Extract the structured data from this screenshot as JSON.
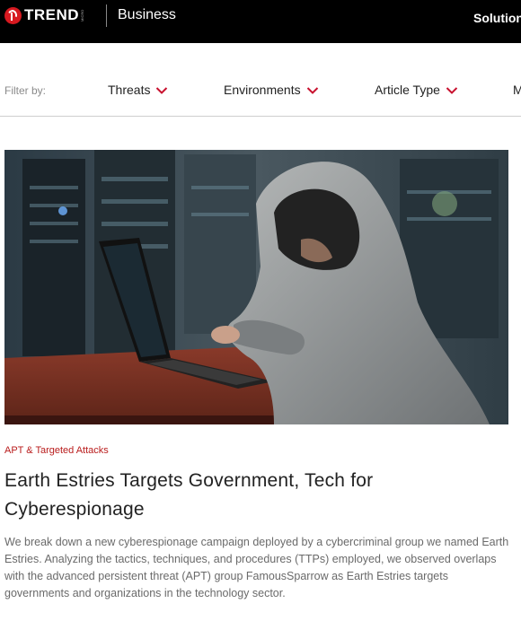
{
  "header": {
    "brand": "TREND",
    "brand_small": "MICRO",
    "section": "Business",
    "nav_item": "Solution"
  },
  "filter_bar": {
    "label": "Filter by:",
    "items": [
      {
        "label": "Threats"
      },
      {
        "label": "Environments"
      },
      {
        "label": "Article Type"
      },
      {
        "label": "M"
      }
    ]
  },
  "article": {
    "category": "APT & Targeted Attacks",
    "title": "Earth Estries Targets Government, Tech for Cyberespionage",
    "summary": "We break down a new cyberespionage campaign deployed by a cybercriminal group we named Earth Estries. Analyzing the tactics, techniques, and procedures (TTPs) employed, we observed overlaps with the advanced persistent threat (APT) group FamousSparrow as Earth Estries targets governments and organizations in the technology sector."
  },
  "colors": {
    "brand_red": "#d71920",
    "category_red": "#b91c1c",
    "chevron_red": "#c8102e"
  },
  "icons": {
    "logo": "trend-micro-logo",
    "dropdown": "chevron-down-icon"
  }
}
